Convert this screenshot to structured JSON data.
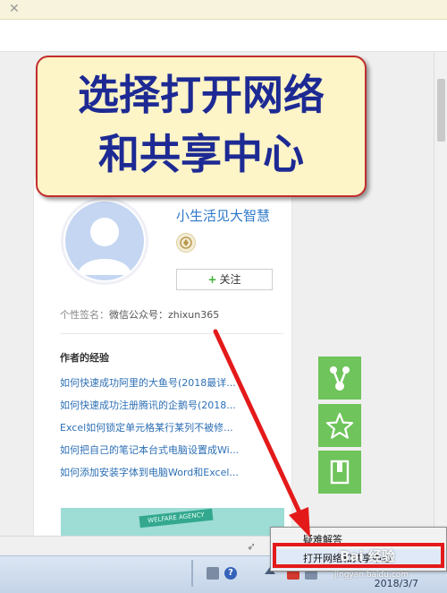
{
  "callout": {
    "line1": "选择打开网络",
    "line2": "和共享中心"
  },
  "profile": {
    "username": "小生活见大智慧",
    "follow_label": "关注",
    "signature_label": "个性签名：",
    "signature_value": "微信公众号：zhixun365"
  },
  "experience": {
    "title": "作者的经验",
    "items": [
      "如何快速成功阿里的大鱼号(2018最详...",
      "如何快速成功注册腾讯的企鹅号(2018...",
      "Excel如何锁定单元格某行某列不被修...",
      "如何把自己的笔记本台式电脑设置成Wi...",
      "如何添加安装字体到电脑Word和Excel..."
    ]
  },
  "banner": {
    "ribbon_text": "WELFARE AGENCY"
  },
  "context_menu": {
    "items": [
      "疑难解答",
      "打开网络和共享中心"
    ]
  },
  "taskbar": {
    "help_glyph": "?",
    "date": "2018/3/7"
  },
  "watermark": {
    "brand": "Bai 经验",
    "url": "jingyan.baidu.com"
  },
  "colors": {
    "callout_text": "#1d2a94",
    "callout_border": "#c22d2d",
    "link": "#2d6fb5",
    "side_button": "#6fc45b",
    "highlight": "#e41a1a"
  },
  "icons": {
    "side_share": "share-icon",
    "side_favorite": "star-icon",
    "side_doc": "document-icon"
  }
}
